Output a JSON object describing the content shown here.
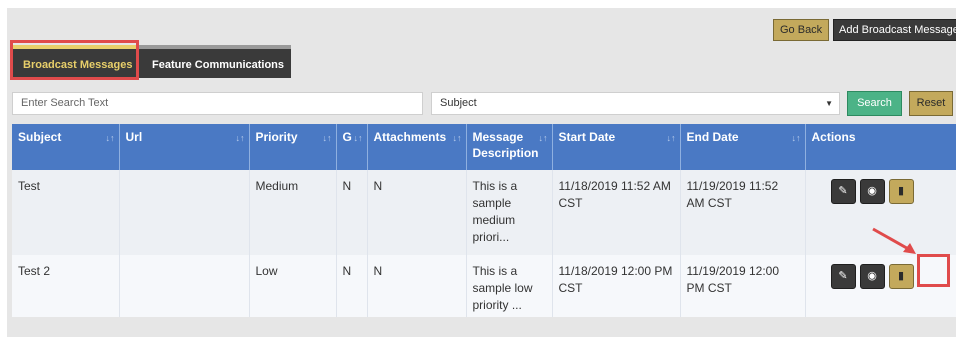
{
  "top_buttons": {
    "go_back": "Go Back",
    "add_broadcast": "Add Broadcast Message"
  },
  "tabs": [
    {
      "label": "Broadcast Messages",
      "active": true
    },
    {
      "label": "Feature Communications",
      "active": false
    }
  ],
  "search": {
    "placeholder": "Enter Search Text",
    "field_selected": "Subject",
    "search_label": "Search",
    "reset_label": "Reset"
  },
  "table": {
    "columns": [
      "Subject",
      "Url",
      "Priority",
      "G",
      "Attachments",
      "Message Description",
      "Start Date",
      "End Date",
      "Actions"
    ],
    "rows": [
      {
        "subject": "Test",
        "url": "",
        "priority": "Medium",
        "g": "N",
        "attachments": "N",
        "description": "This is a sample medium priori...",
        "start": "11/18/2019 11:52 AM CST",
        "end": "11/19/2019 11:52 AM CST"
      },
      {
        "subject": "Test 2",
        "url": "",
        "priority": "Low",
        "g": "N",
        "attachments": "N",
        "description": "This is a sample low priority ...",
        "start": "11/18/2019 12:00 PM CST",
        "end": "11/19/2019 12:00 PM CST"
      }
    ]
  },
  "icons": {
    "edit": "edit-icon",
    "view": "eye-icon",
    "delete": "trash-icon",
    "sort": "sort-icon"
  },
  "colors": {
    "header_blue": "#4a79c4",
    "gold": "#c3a95c",
    "green": "#4cb387",
    "dark": "#3a3a3a",
    "highlight": "#e04b4b"
  }
}
